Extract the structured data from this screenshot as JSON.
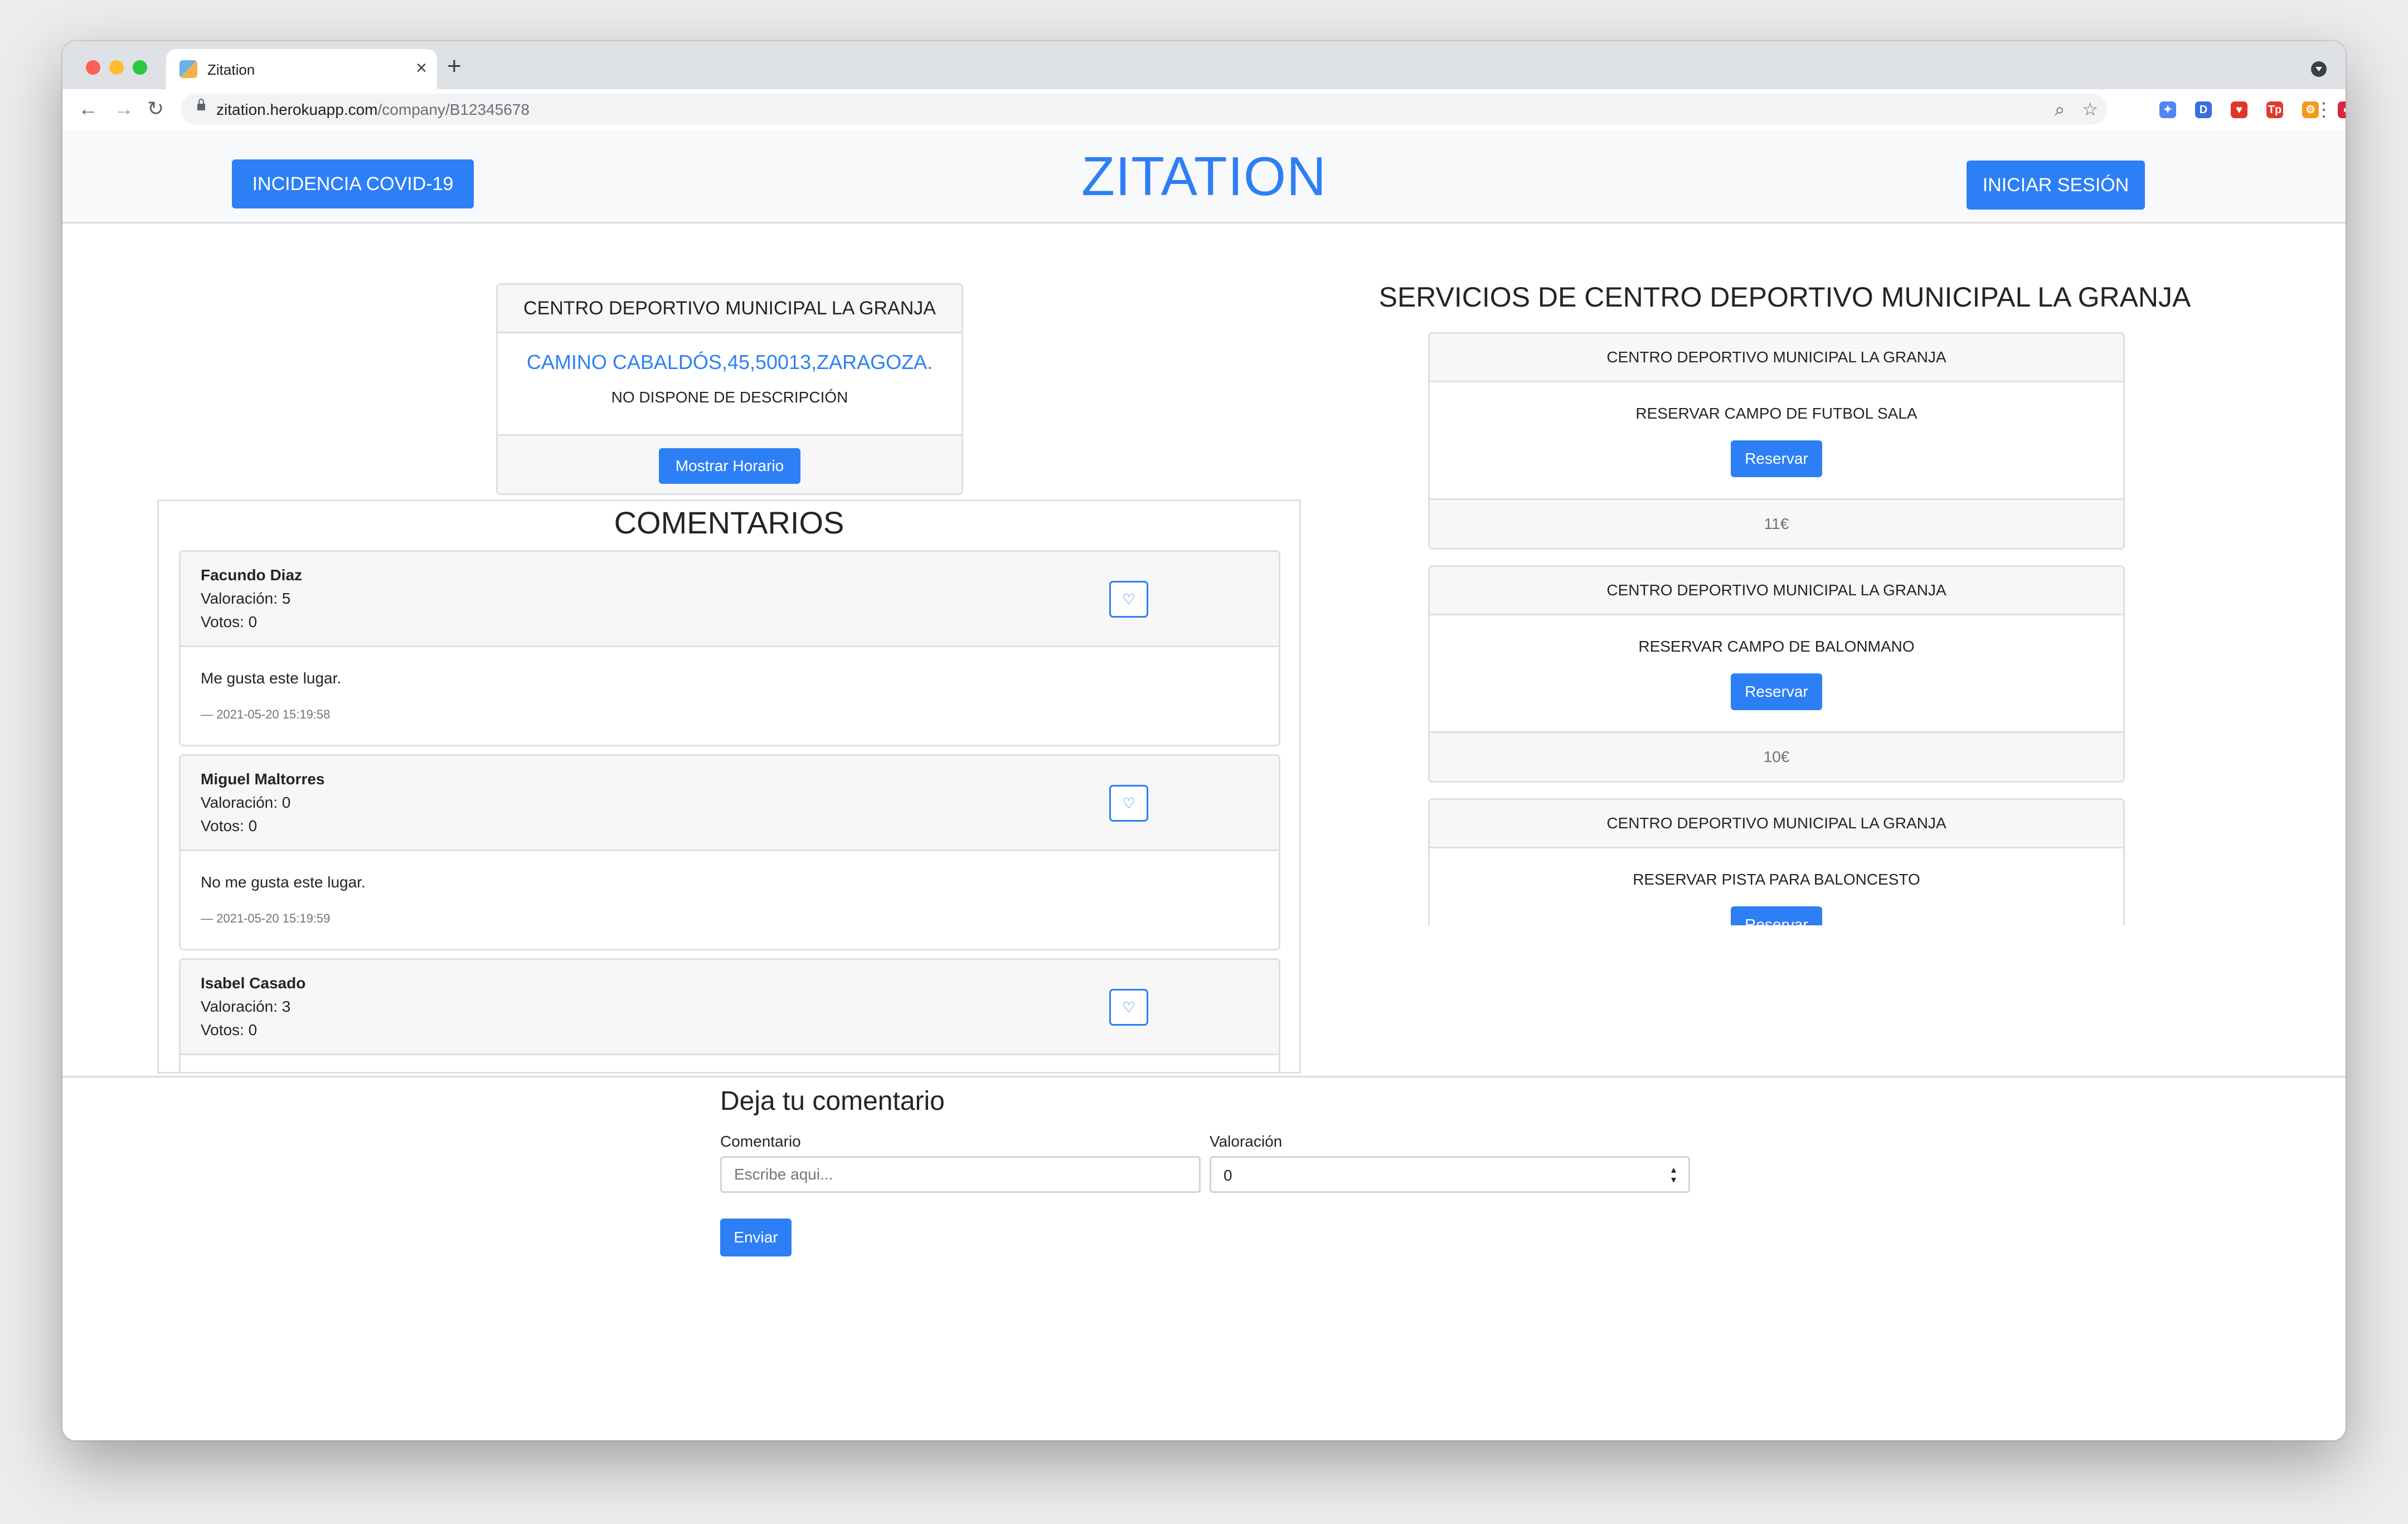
{
  "browser": {
    "tab_title": "Zitation",
    "tab_close": "×",
    "new_tab": "+",
    "url_domain": "zitation.herokuapp.com",
    "url_path": "/company/B12345678",
    "back_icon": "←",
    "forward_icon": "→",
    "reload_icon": "↻",
    "zoom_icon": "⌕",
    "star_icon": "☆",
    "menu_icon": "⋮",
    "extensions": [
      {
        "name": "feather-extension-icon",
        "glyph": "✦",
        "color": "#4f86f7"
      },
      {
        "name": "d-extension-icon",
        "glyph": "D",
        "color": "#3b6fe0"
      },
      {
        "name": "shield-extension-icon",
        "glyph": "♥",
        "color": "#e0352b"
      },
      {
        "name": "tp-extension-icon",
        "glyph": "Tp",
        "color": "#e23a2e"
      },
      {
        "name": "settings-extension-icon",
        "glyph": "⚙",
        "color": "#f29b19"
      },
      {
        "name": "red-circle-extension-icon",
        "glyph": "●",
        "color": "#d7263d"
      },
      {
        "name": "puzzle-extension-icon",
        "glyph": "✚",
        "color": "#5f6368"
      },
      {
        "name": "avatar-icon",
        "glyph": "●",
        "color": "#7a5a48"
      }
    ]
  },
  "header": {
    "brand": "ZITATION",
    "covid_button": "INCIDENCIA COVID-19",
    "login_button": "INICIAR SESIÓN"
  },
  "company": {
    "name": "CENTRO DEPORTIVO MUNICIPAL LA GRANJA",
    "address": "CAMINO CABALDÓS,45,50013,ZARAGOZA.",
    "description": "NO DISPONE DE DESCRIPCIÓN",
    "schedule_button": "Mostrar Horario"
  },
  "comments": {
    "title": "COMENTARIOS",
    "items": [
      {
        "author": "Facundo Diaz",
        "rating": "Valoración: 5",
        "votes": "Votos: 0",
        "text": "Me gusta este lugar.",
        "date": "— 2021-05-20 15:19:58"
      },
      {
        "author": "Miguel Maltorres",
        "rating": "Valoración: 0",
        "votes": "Votos: 0",
        "text": "No me gusta este lugar.",
        "date": "— 2021-05-20 15:19:59"
      },
      {
        "author": "Isabel Casado",
        "rating": "Valoración: 3",
        "votes": "Votos: 0"
      }
    ],
    "heart_glyph": "♡"
  },
  "services": {
    "title": "SERVICIOS DE CENTRO DEPORTIVO MUNICIPAL LA GRANJA",
    "items": [
      {
        "provider": "CENTRO DEPORTIVO MUNICIPAL LA GRANJA",
        "name": "RESERVAR CAMPO DE FUTBOL SALA",
        "button": "Reservar",
        "price": "11€"
      },
      {
        "provider": "CENTRO DEPORTIVO MUNICIPAL LA GRANJA",
        "name": "RESERVAR CAMPO DE BALONMANO",
        "button": "Reservar",
        "price": "10€"
      },
      {
        "provider": "CENTRO DEPORTIVO MUNICIPAL LA GRANJA",
        "name": "RESERVAR PISTA PARA BALONCESTO",
        "button": "Reservar"
      }
    ]
  },
  "comment_form": {
    "title": "Deja tu comentario",
    "comment_label": "Comentario",
    "comment_placeholder": "Escribe aqui...",
    "rating_label": "Valoración",
    "rating_value": "0",
    "submit": "Enviar"
  }
}
